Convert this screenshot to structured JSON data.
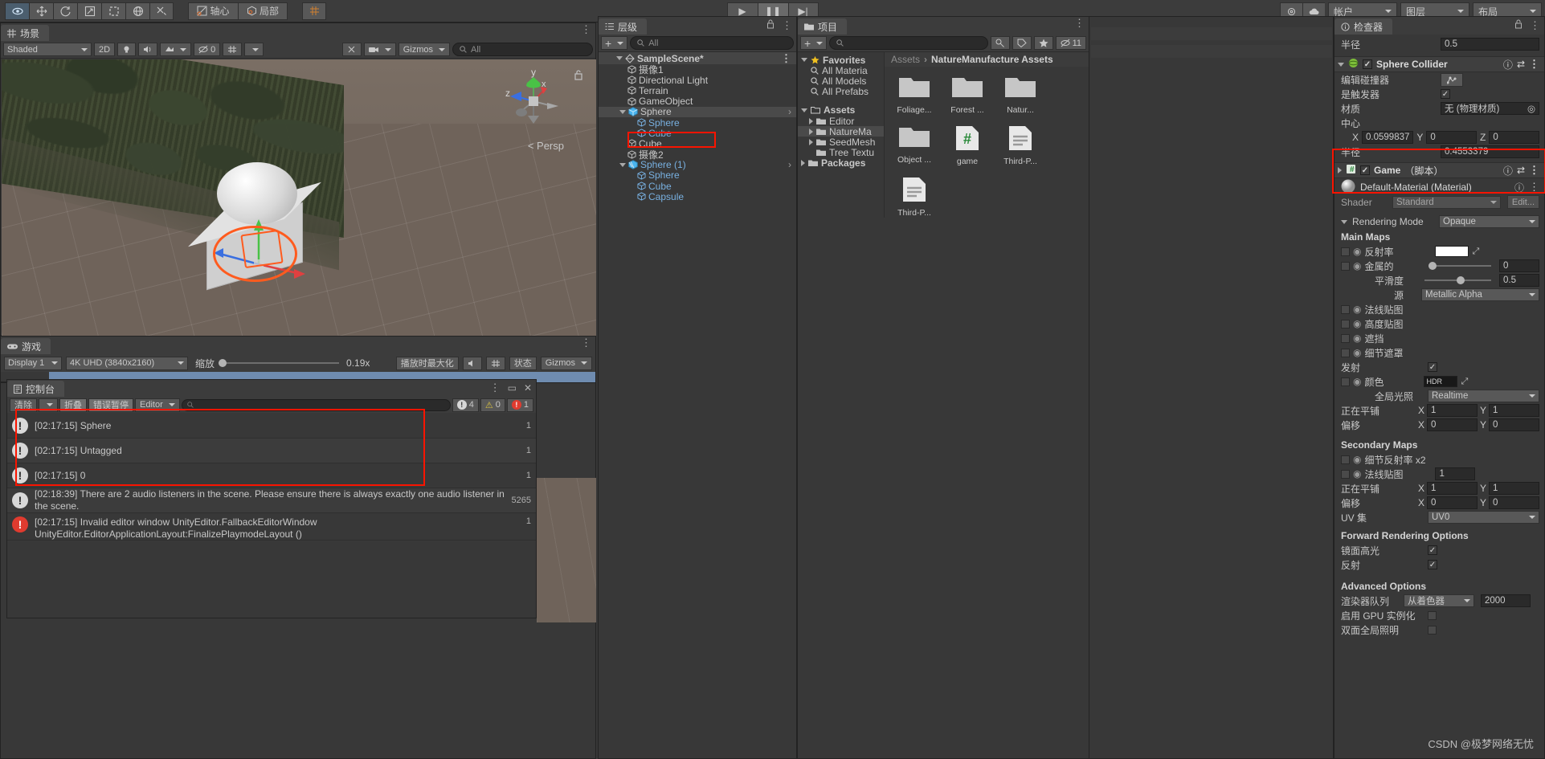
{
  "toolbar": {
    "tools": [
      {
        "name": "hand-tool",
        "icon": "eye"
      },
      {
        "name": "move-tool",
        "icon": "move"
      },
      {
        "name": "rotate-tool",
        "icon": "rotate"
      },
      {
        "name": "scale-tool",
        "icon": "scale"
      },
      {
        "name": "rect-tool",
        "icon": "rect"
      },
      {
        "name": "transform-tool",
        "icon": "transform"
      },
      {
        "name": "custom-tool",
        "icon": "wrench"
      }
    ],
    "pivot_label": "轴心",
    "local_label": "局部",
    "grid_label": "grid",
    "play_label": "▶",
    "pause_label": "❚❚",
    "step_label": "▶|",
    "cloud_label": "cloud",
    "account_label": "帐户",
    "layers_label": "图层",
    "layout_label": "布局"
  },
  "scene": {
    "tab_label": "场景",
    "shading": "Shaded",
    "twod_label": "2D",
    "audio_count": "0",
    "gizmos_label": "Gizmos",
    "search_placeholder": "All",
    "persp_label": "Persp",
    "axis_x": "x",
    "axis_y": "y",
    "axis_z": "z"
  },
  "game": {
    "tab_label": "游戏",
    "display": "Display 1",
    "resolution": "4K UHD (3840x2160)",
    "scale_label": "缩放",
    "scale_value": "0.19x",
    "maximize_label": "播放时最大化",
    "stats_label": "状态",
    "gizmos_label": "Gizmos"
  },
  "console": {
    "tab_label": "控制台",
    "clear_label": "清除",
    "collapse_label": "折叠",
    "error_pause_label": "错误暂停",
    "editor_label": "Editor",
    "search_placeholder": "",
    "counts": {
      "log": "4",
      "warn": "0",
      "error": "1"
    },
    "entries": [
      {
        "type": "warning",
        "message": "[02:17:15] Sphere",
        "count": "1"
      },
      {
        "type": "warning",
        "message": "[02:17:15] Untagged",
        "count": "1"
      },
      {
        "type": "warning",
        "message": "[02:17:15] 0",
        "count": "1"
      },
      {
        "type": "warning",
        "message": "[02:18:39] There are 2 audio listeners in the scene. Please ensure there is always exactly one audio listener in the scene.",
        "count": "5265"
      },
      {
        "type": "error",
        "message": "[02:17:15] Invalid editor window UnityEditor.FallbackEditorWindow\nUnityEditor.EditorApplicationLayout:FinalizePlaymodeLayout ()",
        "count": "1"
      }
    ]
  },
  "hierarchy": {
    "tab_label": "层级",
    "add_label": "+",
    "search_placeholder": "All",
    "scene_name": "SampleScene*",
    "items": [
      {
        "label": "摄像1",
        "depth": 1,
        "type": "gameobject",
        "expandable": false,
        "selected": false
      },
      {
        "label": "Directional Light",
        "depth": 1,
        "type": "gameobject",
        "expandable": false,
        "selected": false
      },
      {
        "label": "Terrain",
        "depth": 1,
        "type": "gameobject",
        "expandable": false,
        "selected": false
      },
      {
        "label": "GameObject",
        "depth": 1,
        "type": "gameobject",
        "expandable": false,
        "selected": false
      },
      {
        "label": "Sphere",
        "depth": 1,
        "type": "prefab-root",
        "expandable": true,
        "selected": true
      },
      {
        "label": "Sphere",
        "depth": 2,
        "type": "prefab",
        "expandable": false,
        "selected": false
      },
      {
        "label": "Cube",
        "depth": 2,
        "type": "prefab",
        "expandable": false,
        "selected": false
      },
      {
        "label": "Cube",
        "depth": 1,
        "type": "gameobject",
        "expandable": false,
        "selected": false
      },
      {
        "label": "摄像2",
        "depth": 1,
        "type": "gameobject",
        "expandable": false,
        "selected": false
      },
      {
        "label": "Sphere (1)",
        "depth": 1,
        "type": "prefab-instance",
        "expandable": true,
        "selected": false
      },
      {
        "label": "Sphere",
        "depth": 2,
        "type": "prefab",
        "expandable": false,
        "selected": false
      },
      {
        "label": "Cube",
        "depth": 2,
        "type": "prefab",
        "expandable": false,
        "selected": false
      },
      {
        "label": "Capsule",
        "depth": 2,
        "type": "prefab",
        "expandable": false,
        "selected": false
      }
    ]
  },
  "project": {
    "tab_label": "项目",
    "add_label": "+",
    "search_placeholder": "",
    "favorites_label": "Favorites",
    "favorites": [
      "All Materia",
      "All Models",
      "All Prefabs"
    ],
    "assets_label": "Assets",
    "folders": [
      {
        "label": "Editor",
        "expandable": true,
        "selected": false
      },
      {
        "label": "NatureMa",
        "expandable": true,
        "selected": true
      },
      {
        "label": "SeedMesh",
        "expandable": true,
        "selected": false
      },
      {
        "label": "Tree Textu",
        "expandable": false,
        "selected": false
      }
    ],
    "packages_label": "Packages",
    "breadcrumb": [
      "Assets",
      "NatureManufacture Assets"
    ],
    "badge_count": "11",
    "assets": [
      {
        "label": "Foliage...",
        "icon": "folder"
      },
      {
        "label": "Forest ...",
        "icon": "folder"
      },
      {
        "label": "Natur...",
        "icon": "folder"
      },
      {
        "label": "Object ...",
        "icon": "folder"
      },
      {
        "label": "game",
        "icon": "csharp"
      },
      {
        "label": "Third-P...",
        "icon": "text"
      },
      {
        "label": "Third-P...",
        "icon": "text"
      }
    ]
  },
  "inspector": {
    "tab_label": "检查器",
    "radius_top_label": "半径",
    "radius_top_value": "0.5",
    "sphere_collider": {
      "title": "Sphere Collider",
      "edit_collider_label": "编辑碰撞器",
      "is_trigger_label": "是触发器",
      "material_label": "材质",
      "material_value": "无 (物理材质)",
      "center_label": "中心",
      "center_x_label": "X",
      "center_x": "0.0599837",
      "center_y_label": "Y",
      "center_y": "0",
      "center_z_label": "Z",
      "center_z": "0",
      "radius_label": "半径",
      "radius_value": "0.4553379"
    },
    "game_script": {
      "title": "Game",
      "suffix": "（脚本）"
    },
    "material": {
      "title": "Default-Material (Material)",
      "shader_label": "Shader",
      "shader_value": "Standard",
      "edit_label": "Edit...",
      "rendering_mode_label": "Rendering Mode",
      "rendering_mode_value": "Opaque",
      "main_maps_label": "Main Maps",
      "albedo_label": "反射率",
      "metallic_label": "金属的",
      "metallic_value": "0",
      "smoothness_label": "平滑度",
      "smoothness_value": "0.5",
      "source_label": "源",
      "source_value": "Metallic Alpha",
      "normal_map_label": "法线贴图",
      "height_map_label": "高度贴图",
      "occlusion_label": "遮挡",
      "detail_mask_label": "细节遮罩",
      "emission_label": "发射",
      "color_label": "颜色",
      "hdr_label": "HDR",
      "gi_label": "全局光照",
      "gi_value": "Realtime",
      "tiling_label": "正在平铺",
      "tiling_x": "1",
      "tiling_y": "1",
      "offset_label": "偏移",
      "offset_x": "0",
      "offset_y": "0",
      "secondary_maps_label": "Secondary Maps",
      "detail_albedo_label": "细节反射率 x2",
      "sec_normal_label": "法线贴图",
      "sec_normal_value": "1",
      "sec_tiling_x": "1",
      "sec_tiling_y": "1",
      "sec_offset_x": "0",
      "sec_offset_y": "0",
      "uv_set_label": "UV 集",
      "uv_set_value": "UV0",
      "forward_label": "Forward Rendering Options",
      "specular_label": "镜面高光",
      "reflections_label": "反射",
      "advanced_label": "Advanced Options",
      "render_queue_label": "渲染器队列",
      "render_queue_value": "从着色器",
      "render_queue_number": "2000",
      "gpu_instancing_label": "启用 GPU 实例化",
      "double_sided_label": "双面全局照明"
    },
    "x_label": "X",
    "y_label": "Y",
    "z_label": "Z"
  },
  "watermark": "CSDN @极梦网络无忧",
  "colors": {
    "accent_blue": "#78b0e0",
    "highlight_red": "#fa1400",
    "selection": "#4a4a4a",
    "orange_gizmo": "#ff5b1e"
  }
}
